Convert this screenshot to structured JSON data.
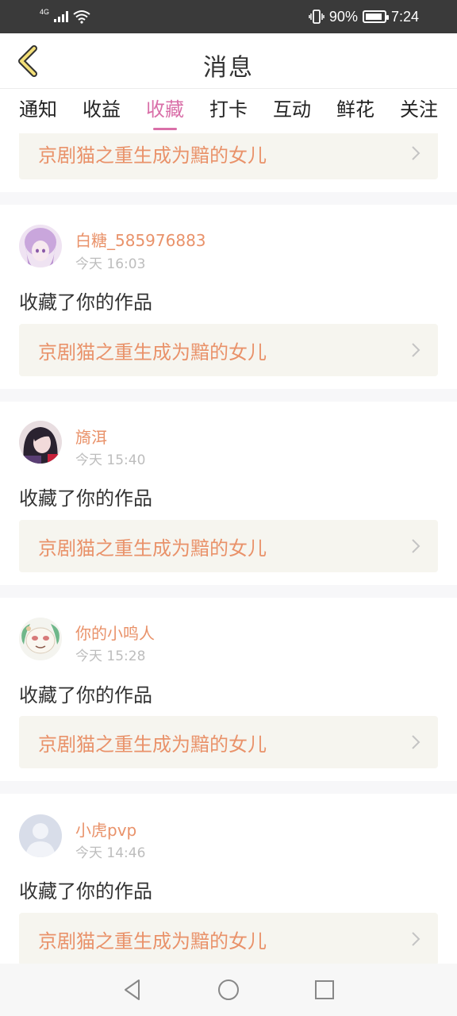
{
  "status_bar": {
    "network": "4G",
    "battery_percent": "90%",
    "battery_level": 0.9,
    "time": "7:24"
  },
  "header": {
    "back_icon": "chevron-left-icon",
    "title": "消息"
  },
  "tabs": [
    {
      "label": "通知",
      "active": false
    },
    {
      "label": "收益",
      "active": false
    },
    {
      "label": "收藏",
      "active": true
    },
    {
      "label": "打卡",
      "active": false
    },
    {
      "label": "互动",
      "active": false
    },
    {
      "label": "鲜花",
      "active": false
    },
    {
      "label": "关注",
      "active": false
    }
  ],
  "partial_item": {
    "work_title": "京剧猫之重生成为黯的女儿"
  },
  "items": [
    {
      "name": "白糖_585976883",
      "time": "今天 16:03",
      "action": "收藏了你的作品",
      "work_title": "京剧猫之重生成为黯的女儿"
    },
    {
      "name": "旖洱",
      "time": "今天 15:40",
      "action": "收藏了你的作品",
      "work_title": "京剧猫之重生成为黯的女儿"
    },
    {
      "name": "你的小鸣人",
      "time": "今天 15:28",
      "action": "收藏了你的作品",
      "work_title": "京剧猫之重生成为黯的女儿"
    },
    {
      "name": "小虎pvp",
      "time": "今天 14:46",
      "action": "收藏了你的作品",
      "work_title": "京剧猫之重生成为黯的女儿"
    }
  ],
  "colors": {
    "accent": "#d96fa8",
    "username": "#e9926a",
    "card_bg": "#f6f5ef",
    "status_bar": "#3a3a3a"
  },
  "nav_bar": {
    "icons": [
      "back-triangle-icon",
      "home-circle-icon",
      "recents-square-icon"
    ]
  }
}
